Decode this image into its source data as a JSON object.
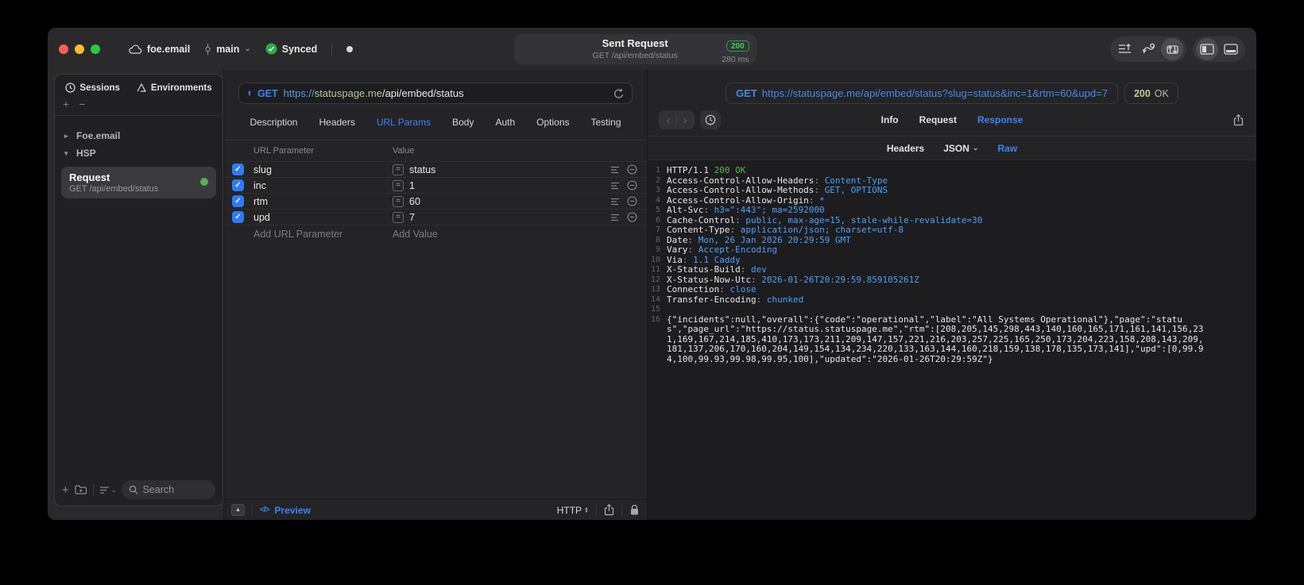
{
  "colors": {
    "accent_blue": "#3f82f7",
    "code_value_blue": "#4ba1f7",
    "code_status_green": "#5cb83c",
    "checkbox_blue": "#2e7bf6",
    "badge_green": "#3fcf5e",
    "status_pill_green": "#b9cf92",
    "traffic_red": "#ff5f57",
    "traffic_yellow": "#febc2e",
    "traffic_green": "#28c840"
  },
  "titlebar": {
    "project": "foe.email",
    "branch": "main",
    "sync_label": "Synced",
    "center": {
      "title": "Sent Request",
      "subtitle": "GET /api/embed/status",
      "status_code": "200",
      "duration": "280 ms"
    }
  },
  "sidebar": {
    "tabs": [
      {
        "label": "Sessions"
      },
      {
        "label": "Environments"
      }
    ],
    "tree": {
      "group1": "Foe.email",
      "group2": "HSP"
    },
    "request_item": {
      "title": "Request",
      "subtitle": "GET /api/embed/status"
    },
    "search_placeholder": "Search"
  },
  "request_pane": {
    "method": "GET",
    "url_scheme": "https://",
    "url_host": "statuspage.me",
    "url_path": "/api/embed/status",
    "tabs": [
      "Description",
      "Headers",
      "URL Params",
      "Body",
      "Auth",
      "Options",
      "Testing"
    ],
    "active_tab": "URL Params",
    "params_table": {
      "columns": [
        "URL Parameter",
        "Value"
      ],
      "rows": [
        {
          "enabled": true,
          "name": "slug",
          "value": "status"
        },
        {
          "enabled": true,
          "name": "inc",
          "value": "1"
        },
        {
          "enabled": true,
          "name": "rtm",
          "value": "60"
        },
        {
          "enabled": true,
          "name": "upd",
          "value": "7"
        }
      ],
      "add_name_placeholder": "Add URL Parameter",
      "add_value_placeholder": "Add Value"
    },
    "footer": {
      "preview_label": "Preview",
      "protocol": "HTTP"
    }
  },
  "response_pane": {
    "request_method": "GET",
    "request_url": "https://statuspage.me/api/embed/status?slug=status&inc=1&rtm=60&upd=7",
    "status_code": "200",
    "status_text": "OK",
    "tabs": [
      {
        "label": "Info"
      },
      {
        "label": "Request"
      },
      {
        "label": "Response",
        "active": true
      }
    ],
    "subtabs": [
      {
        "label": "Headers"
      },
      {
        "label": "JSON",
        "chevron": true
      },
      {
        "label": "Raw",
        "active": true
      }
    ],
    "code": {
      "status_line": {
        "protocol": "HTTP/1.1",
        "status": "200 OK"
      },
      "headers": [
        {
          "name": "Access-Control-Allow-Headers",
          "value": "Content-Type"
        },
        {
          "name": "Access-Control-Allow-Methods",
          "value": "GET, OPTIONS"
        },
        {
          "name": "Access-Control-Allow-Origin",
          "value": "*"
        },
        {
          "name": "Alt-Svc",
          "value": "h3=\":443\"; ma=2592000"
        },
        {
          "name": "Cache-Control",
          "value": "public, max-age=15, stale-while-revalidate=30"
        },
        {
          "name": "Content-Type",
          "value": "application/json; charset=utf-8"
        },
        {
          "name": "Date",
          "value": "Mon, 26 Jan 2026 20:29:59 GMT"
        },
        {
          "name": "Vary",
          "value": "Accept-Encoding"
        },
        {
          "name": "Via",
          "value": "1.1 Caddy"
        },
        {
          "name": "X-Status-Build",
          "value": "dev"
        },
        {
          "name": "X-Status-Now-Utc",
          "value": "2026-01-26T20:29:59.859105261Z"
        },
        {
          "name": "Connection",
          "value": "close"
        },
        {
          "name": "Transfer-Encoding",
          "value": "chunked"
        }
      ],
      "body": "{\"incidents\":null,\"overall\":{\"code\":\"operational\",\"label\":\"All Systems Operational\"},\"page\":\"status\",\"page_url\":\"https://status.statuspage.me\",\"rtm\":[208,205,145,298,443,140,160,165,171,161,141,156,231,169,167,214,185,410,173,173,211,209,147,157,221,216,203,257,225,165,250,173,204,223,158,208,143,209,181,137,206,170,160,204,149,154,134,234,220,133,163,144,160,218,159,138,178,135,173,141],\"upd\":[0,99.94,100,99.93,99.98,99.95,100],\"updated\":\"2026-01-26T20:29:59Z\"}"
    }
  }
}
